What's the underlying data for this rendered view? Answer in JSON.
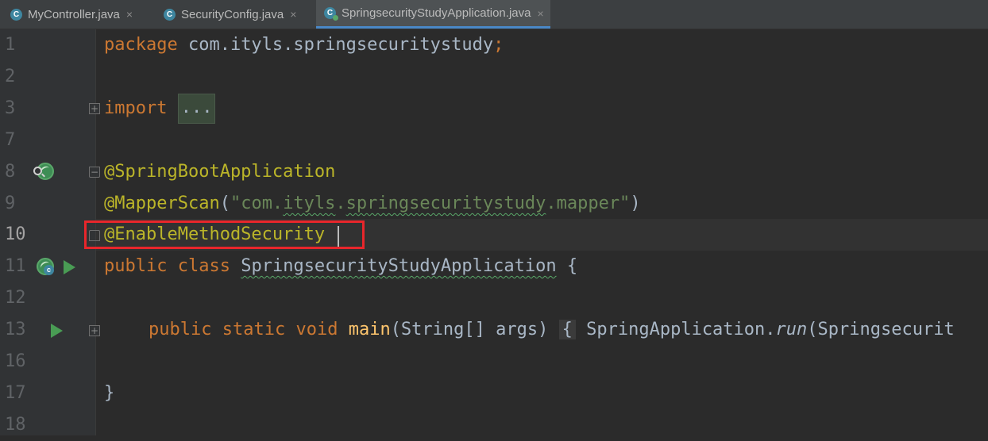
{
  "tabs": [
    {
      "label": "MyController.java",
      "icon": "C",
      "close": "×",
      "active": false
    },
    {
      "label": "SecurityConfig.java",
      "icon": "C",
      "close": "×",
      "active": false
    },
    {
      "label": "SpringsecurityStudyApplication.java",
      "icon": "C",
      "close": "×",
      "active": true
    }
  ],
  "line_numbers": [
    "1",
    "2",
    "3",
    "7",
    "8",
    "9",
    "10",
    "11",
    "12",
    "13",
    "16",
    "17",
    "18"
  ],
  "code": {
    "l1_kw": "package",
    "l1_rest": " com.ityls.springsecuritystudy",
    "l1_semi": ";",
    "l3_kw": "import",
    "l3_folded": "...",
    "l8_ann": "@SpringBootApplication",
    "l9_ann": "@MapperScan",
    "l9_open": "(",
    "l9_str_a": "\"com.",
    "l9_str_b": "ityls",
    "l9_str_c": ".",
    "l9_str_d": "springsecuritystudy",
    "l9_str_e": ".mapper\"",
    "l9_close": ")",
    "l10_ann": "@EnableMethodSecurity",
    "l11_kw1": "public",
    "l11_kw2": "class",
    "l11_name": "SpringsecurityStudyApplication",
    "l11_brace": " {",
    "l13_kw1": "public",
    "l13_kw2": "static",
    "l13_kw3": "void",
    "l13_fn": "main",
    "l13_params": "(String[] args)",
    "l13_brace": "{",
    "l13_call_a": " SpringApplication.",
    "l13_call_b": "run",
    "l13_call_c": "(Springsecurit",
    "l17_brace": "}"
  },
  "colors": {
    "keyword": "#cc7832",
    "annotation": "#bbb529",
    "string": "#6a8759",
    "function": "#ffc66d",
    "highlight_box": "#e8262b"
  },
  "icons": [
    "spring-bean-icon",
    "find-usages-icon",
    "class-icon",
    "run-icon"
  ]
}
